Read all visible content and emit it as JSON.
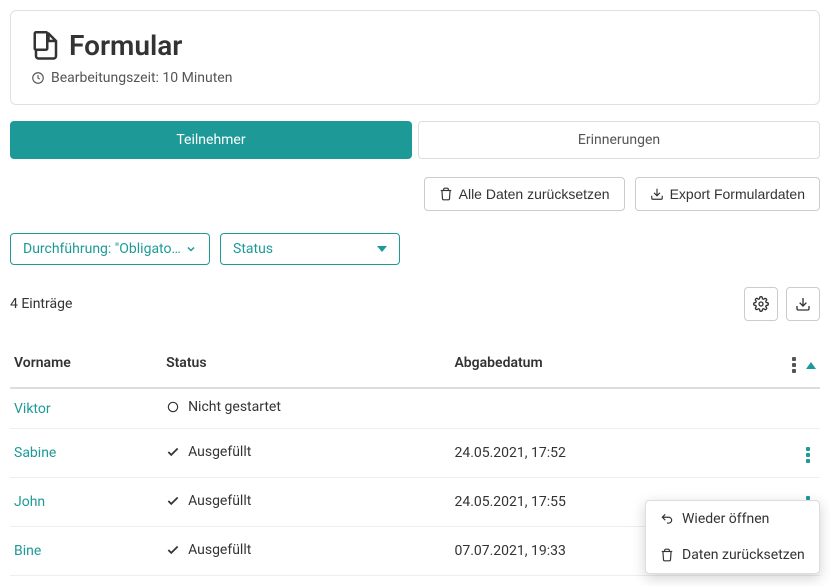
{
  "header": {
    "title": "Formular",
    "editing_time_label": "Bearbeitungszeit: 10 Minuten"
  },
  "tabs": {
    "participants": "Teilnehmer",
    "reminders": "Erinnerungen"
  },
  "toolbar": {
    "reset_all": "Alle Daten zurücksetzen",
    "export": "Export Formulardaten"
  },
  "filters": {
    "execution_label": "Durchführung:",
    "execution_value": "\"Obligatorisc...",
    "status_label": "Status"
  },
  "count_text": "4 Einträge",
  "columns": {
    "firstname": "Vorname",
    "status": "Status",
    "submission_date": "Abgabedatum"
  },
  "status_values": {
    "not_started": "Nicht gestartet",
    "filled": "Ausgefüllt"
  },
  "rows": [
    {
      "firstname": "Viktor",
      "status": "not_started",
      "date": ""
    },
    {
      "firstname": "Sabine",
      "status": "filled",
      "date": "24.05.2021, 17:52"
    },
    {
      "firstname": "John",
      "status": "filled",
      "date": "24.05.2021, 17:55"
    },
    {
      "firstname": "Bine",
      "status": "filled",
      "date": "07.07.2021, 19:33"
    }
  ],
  "menu": {
    "reopen": "Wieder öffnen",
    "reset": "Daten zurücksetzen"
  }
}
